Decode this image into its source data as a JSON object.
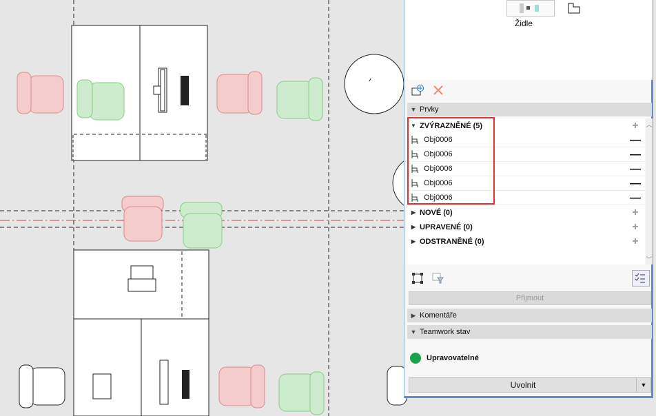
{
  "preview": {
    "object_name": "Židle"
  },
  "toolbar": {
    "add_icon": "add-layer-icon",
    "delete_icon": "delete-x-icon"
  },
  "sections": {
    "elements": "Prvky",
    "comments": "Komentáře",
    "teamwork": "Teamwork stav"
  },
  "tree": {
    "highlighted": {
      "label": "ZVÝRAZNĚNÉ (5)",
      "items": [
        "Obj0006",
        "Obj0006",
        "Obj0006",
        "Obj0006",
        "Obj0006"
      ]
    },
    "new": {
      "label": "NOVÉ (0)"
    },
    "modified": {
      "label": "UPRAVENÉ (0)"
    },
    "deleted": {
      "label": "ODSTRANĚNÉ (0)"
    }
  },
  "buttons": {
    "accept": "Přijmout",
    "release": "Uvolnit"
  },
  "status": {
    "label": "Upravovatelné",
    "color": "#19a34a"
  },
  "colors": {
    "highlight_box": "#e0302f",
    "panel_border": "#5b8fd0",
    "deleted_chair": "#f2c4c4",
    "new_chair": "#cdeccd"
  }
}
